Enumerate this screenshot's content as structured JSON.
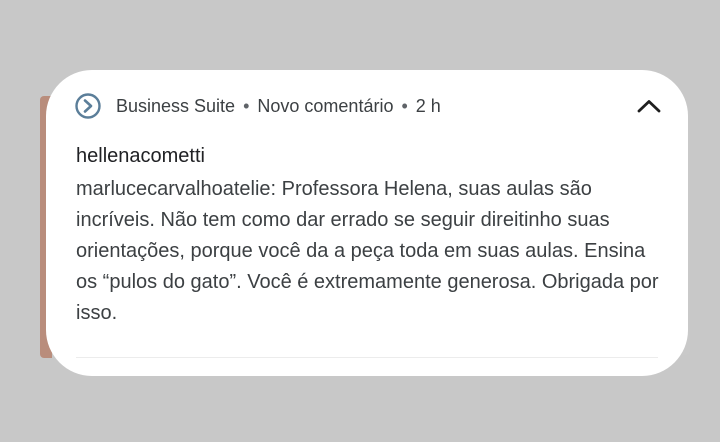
{
  "notification": {
    "app_name": "Business Suite",
    "separator": "•",
    "category": "Novo comentário",
    "time": "2 h",
    "title": "hellenacometti",
    "body": "marlucecarvalhoatelie: Professora Helena, suas aulas são incríveis. Não tem como dar errado se seguir direitinho suas orientações, porque você da a peça toda em suas aulas. Ensina os “pulos do gato”. Você é extremamente generosa. Obrigada por isso.",
    "icons": {
      "app": "business-suite-icon",
      "collapse": "chevron-up-icon"
    },
    "colors": {
      "icon_blue": "#5b7e99",
      "background": "#c8c8c8",
      "card": "#ffffff"
    }
  }
}
